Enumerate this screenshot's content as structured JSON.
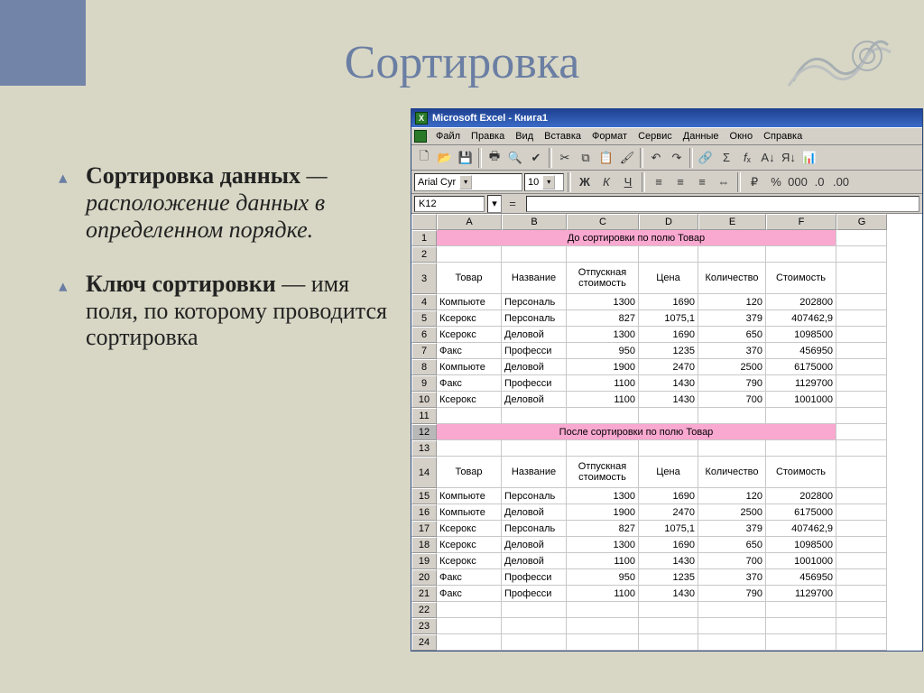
{
  "slide": {
    "title": "Сортировка",
    "bullets": [
      {
        "term": "Сортировка данных",
        "rest": " — расположение данных в определенном порядке.",
        "italic_rest": true
      },
      {
        "term": "Ключ сортировки",
        "rest": " — имя поля, по которому проводится сортировка",
        "italic_rest": false
      }
    ]
  },
  "excel": {
    "window_title": "Microsoft Excel - Книга1",
    "menus": [
      "Файл",
      "Правка",
      "Вид",
      "Вставка",
      "Формат",
      "Сервис",
      "Данные",
      "Окно",
      "Справка"
    ],
    "font_name": "Arial Cyr",
    "font_size": "10",
    "name_box": "K12",
    "formula_bar": "",
    "format_buttons": [
      "Ж",
      "К",
      "Ч"
    ],
    "columns": [
      "A",
      "B",
      "C",
      "D",
      "E",
      "F",
      "G"
    ],
    "selected_row": 12,
    "banner1": "До сортировки по полю Товар",
    "banner2": "После сортировки по полю Товар",
    "headers": [
      "Товар",
      "Название",
      "Отпускная стоимость",
      "Цена",
      "Количество",
      "Стоимость"
    ],
    "rows_before": [
      [
        "Компьюте",
        "Персональ",
        "1300",
        "1690",
        "120",
        "202800"
      ],
      [
        "Ксерокс",
        "Персональ",
        "827",
        "1075,1",
        "379",
        "407462,9"
      ],
      [
        "Ксерокс",
        "Деловой",
        "1300",
        "1690",
        "650",
        "1098500"
      ],
      [
        "Факс",
        "Професси",
        "950",
        "1235",
        "370",
        "456950"
      ],
      [
        "Компьюте",
        "Деловой",
        "1900",
        "2470",
        "2500",
        "6175000"
      ],
      [
        "Факс",
        "Професси",
        "1100",
        "1430",
        "790",
        "1129700"
      ],
      [
        "Ксерокс",
        "Деловой",
        "1100",
        "1430",
        "700",
        "1001000"
      ]
    ],
    "rows_after": [
      [
        "Компьюте",
        "Персональ",
        "1300",
        "1690",
        "120",
        "202800"
      ],
      [
        "Компьюте",
        "Деловой",
        "1900",
        "2470",
        "2500",
        "6175000"
      ],
      [
        "Ксерокс",
        "Персональ",
        "827",
        "1075,1",
        "379",
        "407462,9"
      ],
      [
        "Ксерокс",
        "Деловой",
        "1300",
        "1690",
        "650",
        "1098500"
      ],
      [
        "Ксерокс",
        "Деловой",
        "1100",
        "1430",
        "700",
        "1001000"
      ],
      [
        "Факс",
        "Професси",
        "950",
        "1235",
        "370",
        "456950"
      ],
      [
        "Факс",
        "Професси",
        "1100",
        "1430",
        "790",
        "1129700"
      ]
    ]
  },
  "chart_data": {
    "type": "table",
    "title": "Sorting example: before and after sorting by field Товар",
    "columns": [
      "Товар",
      "Название",
      "Отпускная стоимость",
      "Цена",
      "Количество",
      "Стоимость"
    ],
    "before": [
      {
        "Товар": "Компьютер",
        "Название": "Персональный",
        "Отпускная стоимость": 1300,
        "Цена": 1690,
        "Количество": 120,
        "Стоимость": 202800
      },
      {
        "Товар": "Ксерокс",
        "Название": "Персональный",
        "Отпускная стоимость": 827,
        "Цена": 1075.1,
        "Количество": 379,
        "Стоимость": 407462.9
      },
      {
        "Товар": "Ксерокс",
        "Название": "Деловой",
        "Отпускная стоимость": 1300,
        "Цена": 1690,
        "Количество": 650,
        "Стоимость": 1098500
      },
      {
        "Товар": "Факс",
        "Название": "Профессиональный",
        "Отпускная стоимость": 950,
        "Цена": 1235,
        "Количество": 370,
        "Стоимость": 456950
      },
      {
        "Товар": "Компьютер",
        "Название": "Деловой",
        "Отпускная стоимость": 1900,
        "Цена": 2470,
        "Количество": 2500,
        "Стоимость": 6175000
      },
      {
        "Товар": "Факс",
        "Название": "Профессиональный",
        "Отпускная стоимость": 1100,
        "Цена": 1430,
        "Количество": 790,
        "Стоимость": 1129700
      },
      {
        "Товар": "Ксерокс",
        "Название": "Деловой",
        "Отпускная стоимость": 1100,
        "Цена": 1430,
        "Количество": 700,
        "Стоимость": 1001000
      }
    ],
    "after": [
      {
        "Товар": "Компьютер",
        "Название": "Персональный",
        "Отпускная стоимость": 1300,
        "Цена": 1690,
        "Количество": 120,
        "Стоимость": 202800
      },
      {
        "Товар": "Компьютер",
        "Название": "Деловой",
        "Отпускная стоимость": 1900,
        "Цена": 2470,
        "Количество": 2500,
        "Стоимость": 6175000
      },
      {
        "Товар": "Ксерокс",
        "Название": "Персональный",
        "Отпускная стоимость": 827,
        "Цена": 1075.1,
        "Количество": 379,
        "Стоимость": 407462.9
      },
      {
        "Товар": "Ксерокс",
        "Название": "Деловой",
        "Отпускная стоимость": 1300,
        "Цена": 1690,
        "Количество": 650,
        "Стоимость": 1098500
      },
      {
        "Товар": "Ксерокс",
        "Название": "Деловой",
        "Отпускная стоимость": 1100,
        "Цена": 1430,
        "Количество": 700,
        "Стоимость": 1001000
      },
      {
        "Товар": "Факс",
        "Название": "Профессиональный",
        "Отпускная стоимость": 950,
        "Цена": 1235,
        "Количество": 370,
        "Стоимость": 456950
      },
      {
        "Товар": "Факс",
        "Название": "Профессиональный",
        "Отпускная стоимость": 1100,
        "Цена": 1430,
        "Количество": 790,
        "Стоимость": 1129700
      }
    ]
  }
}
